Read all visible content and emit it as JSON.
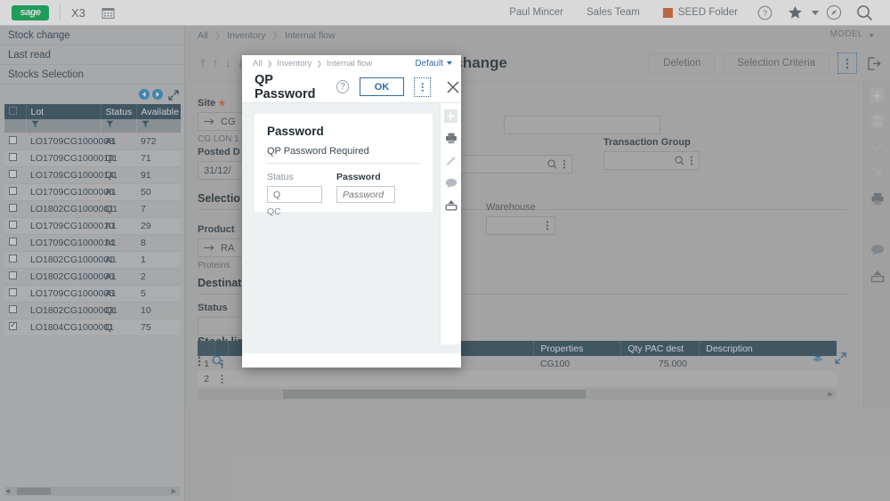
{
  "topbar": {
    "logo_text": "sage",
    "product": "X3",
    "calendar_icon": "calendar-icon",
    "user": "Paul Mincer",
    "team": "Sales Team",
    "folder": "SEED Folder",
    "help_icon": "help-icon",
    "favorites_icon": "star-icon",
    "compass_icon": "compass-icon",
    "search_icon": "search-icon"
  },
  "sidebar": {
    "items": [
      {
        "label": "Stock change"
      },
      {
        "label": "Last read"
      },
      {
        "label": "Stocks Selection"
      }
    ],
    "columns": [
      "Lot",
      "Status",
      "Available"
    ],
    "rows": [
      {
        "lot": "LO1709CG1000008",
        "status": "A1",
        "available": "972",
        "checked": false
      },
      {
        "lot": "LO1709CG1000010",
        "status": "Q1",
        "available": "71",
        "checked": false
      },
      {
        "lot": "LO1709CG1000014",
        "status": "Q1",
        "available": "91",
        "checked": false
      },
      {
        "lot": "LO1709CG1000006",
        "status": "A1",
        "available": "50",
        "checked": false
      },
      {
        "lot": "LO1802CG1000001",
        "status": "Q1",
        "available": "7",
        "checked": false
      },
      {
        "lot": "LO1709CG1000010",
        "status": "A1",
        "available": "29",
        "checked": false
      },
      {
        "lot": "LO1709CG1000014",
        "status": "A1",
        "available": "8",
        "checked": false
      },
      {
        "lot": "LO1802CG1000001",
        "status": "A1",
        "available": "1",
        "checked": false
      },
      {
        "lot": "LO1802CG1000006",
        "status": "A1",
        "available": "2",
        "checked": false
      },
      {
        "lot": "LO1709CG1000005",
        "status": "A1",
        "available": "5",
        "checked": false
      },
      {
        "lot": "LO1802CG1000003",
        "status": "Q1",
        "available": "10",
        "checked": false
      },
      {
        "lot": "LO1804CG1000001",
        "status": "Q",
        "available": "75",
        "checked": true
      }
    ]
  },
  "main": {
    "breadcrumb": [
      "All",
      "Inventory",
      "Internal flow"
    ],
    "model_label": "MODEL",
    "title": "Stock change CHS : Status change",
    "buttons": {
      "deletion": "Deletion",
      "criteria": "Selection Criteria"
    },
    "kebab_icon": "kebab-menu-icon",
    "exit_icon": "exit-icon",
    "fields": {
      "site_label": "Site",
      "site_value": "CG",
      "site_note": "CG LON 1",
      "posted_label": "Posted D",
      "posted_value": "31/12/",
      "selection_section": "Selectio",
      "product_label": "Product",
      "product_value": "RA",
      "product_note": "Proteins",
      "destination_section": "Destinat",
      "status_label": "Status",
      "status_value": "",
      "transaction_group_label": "Transaction Group",
      "transaction_group_value": "",
      "warehouse_label": "Warehouse",
      "warehouse_value": "",
      "stock_lines_label": "Stock lin"
    },
    "grid": {
      "columns": [
        "Properties",
        "Qty PAC dest",
        "Description"
      ],
      "rows": [
        {
          "num": "1",
          "properties": "CG100",
          "qty": "75.000",
          "description": ""
        },
        {
          "num": "2",
          "properties": "",
          "qty": "",
          "description": ""
        }
      ]
    },
    "rail_icons": [
      "add-icon",
      "save-icon",
      "check-icon",
      "close-icon",
      "print-icon",
      "edit-icon",
      "comment-icon",
      "upload-icon"
    ]
  },
  "modal": {
    "breadcrumb": [
      "All",
      "Inventory",
      "Internal flow"
    ],
    "default_label": "Default",
    "title": "QP Password",
    "help_icon": "help-icon",
    "ok_label": "OK",
    "kebab_icon": "kebab-menu-icon",
    "close_icon": "close-icon",
    "card_title": "Password",
    "card_subtitle": "QP Password Required",
    "status_label": "Status",
    "status_value": "Q",
    "status_note": "QC",
    "password_label": "Password",
    "password_placeholder": "Password",
    "rail_icons": [
      "add-icon",
      "print-icon",
      "edit-icon",
      "comment-icon",
      "upload-icon"
    ]
  },
  "colors": {
    "sage_green": "#00a94f",
    "accent_blue": "#2e6da4",
    "header_navy": "#2d4a5c",
    "orange": "#d4622a"
  }
}
